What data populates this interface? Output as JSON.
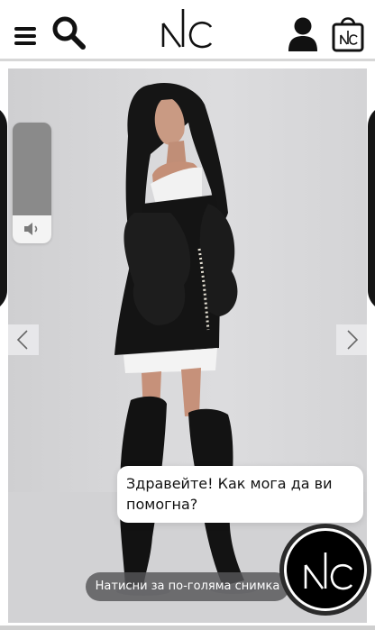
{
  "header": {
    "menu_icon": "hamburger-menu-icon",
    "search_icon": "search-icon",
    "logo_text": "NC",
    "account_icon": "user-icon",
    "cart_icon": "shopping-bag-icon"
  },
  "gallery": {
    "image_alt": "",
    "volume_icon": "speaker-icon",
    "prev_icon": "chevron-left-icon",
    "next_icon": "chevron-right-icon",
    "caption": "Натисни за по-голяма снимка"
  },
  "chat": {
    "greeting": "Здравейте! Как мога да ви помогна?",
    "launcher_logo": "NC"
  },
  "colors": {
    "header_bg": "#ffffff",
    "icon": "#111111",
    "photo_bg": "#d9d9db",
    "caption_bg": "#555558",
    "launcher_bg": "#000000"
  }
}
